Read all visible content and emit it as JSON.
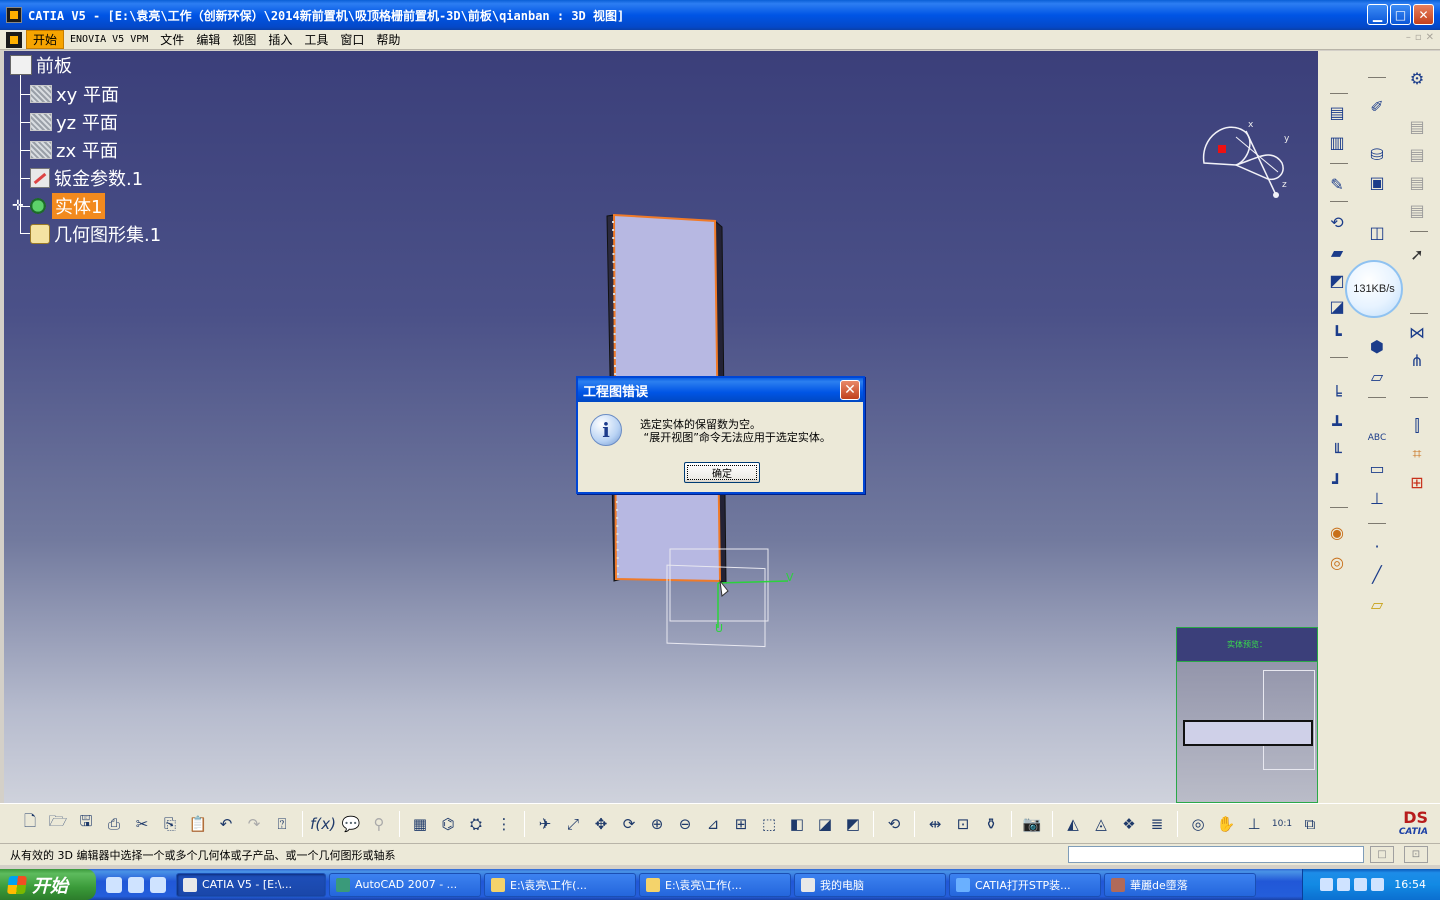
{
  "window": {
    "title": "CATIA V5 - [E:\\袁亮\\工作（创新环保）\\2014新前置机\\吸顶格栅前置机-3D\\前板\\qianban : 3D 视图]",
    "min_label": "▁",
    "max_label": "□",
    "close_label": "✕"
  },
  "menu": {
    "items": [
      "开始",
      "ENOVIA V5 VPM",
      "文件",
      "编辑",
      "视图",
      "插入",
      "工具",
      "窗口",
      "帮助"
    ],
    "mdi": [
      "–",
      "▫",
      "✕"
    ]
  },
  "tree": {
    "root": "前板",
    "items": [
      {
        "label": "xy 平面",
        "icon": "plane-icon"
      },
      {
        "label": "yz 平面",
        "icon": "plane-icon"
      },
      {
        "label": "zx 平面",
        "icon": "plane-icon"
      },
      {
        "label": "钣金参数.1",
        "icon": "sheetmetal-params-icon"
      },
      {
        "label": "实体1",
        "icon": "part-body-icon",
        "highlighted": true
      },
      {
        "label": "几何图形集.1",
        "icon": "geometrical-set-icon"
      }
    ]
  },
  "compass": {
    "x": "x",
    "y": "y",
    "z": "z"
  },
  "axis_labels": {
    "v": "V",
    "u": "U"
  },
  "preview": {
    "header": "实体预览："
  },
  "speed_badge": "131KB/s",
  "dialog": {
    "title": "工程图错误",
    "message_line1": "选定实体的保留数为空。",
    "message_line2": " “展开视图”命令无法应用于选定实体。",
    "ok_label": "确定",
    "close_label": "✕"
  },
  "status": {
    "message": "从有效的 3D 编辑器中选择一个或多个几何体或子产品、或一个几何图形或轴系",
    "btn1": "□",
    "btn2": "⊡"
  },
  "taskbar": {
    "start_label": "开始",
    "tasks": [
      {
        "label": "CATIA V5 - [E:\\...",
        "active": true
      },
      {
        "label": "AutoCAD 2007 - ...",
        "active": false
      },
      {
        "label": "E:\\袁亮\\工作(...",
        "active": false
      },
      {
        "label": "E:\\袁亮\\工作(...",
        "active": false
      },
      {
        "label": "我的电脑",
        "active": false
      },
      {
        "label": "CATIA打开STP装...",
        "active": false
      },
      {
        "label": "華麗de墮落",
        "active": false
      }
    ],
    "clock": "16:54"
  },
  "logo": {
    "mark": "DS",
    "text": "CATIA"
  }
}
